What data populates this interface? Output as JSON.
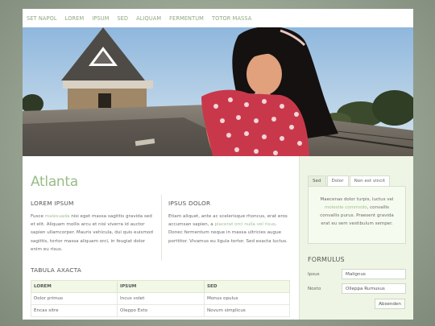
{
  "nav": {
    "items": [
      "Set Napol",
      "Lorem",
      "Ipsum",
      "Sed",
      "Aliquam",
      "Fermentum",
      "Totor Massa"
    ]
  },
  "site_title": "Atlanta",
  "col1": {
    "heading": "Lorem Ipsum",
    "text_a": "Fusce ",
    "link": "malesuada",
    "text_b": " nisi eget massa sagittis gravida sed et elit. Aliquam mollis arcu et nisi viverra id auctor sapien ullamcorper. Mauris vehicula, dui quis euismod sagittis, tortor massa aliquam orci, in feugiat dolor enim eu risus."
  },
  "col2": {
    "heading": "Ipsus Dolor",
    "text_a": "Etiam aliquet, ante ac scelerisque rhoncus, erat eros accumsan sapien, a ",
    "link": "placerat orci nulla vel risus",
    "text_b": ". Donec fermentum neque in massa ultricies augue porttitor. Vivamus eu ligula tortor. Sed exacta luctus."
  },
  "table": {
    "title": "Tabula Axacta",
    "headers": [
      "LOREM",
      "IPSUM",
      "SED"
    ],
    "rows": [
      [
        "Dolor primus",
        "Incus volet",
        "Monus opulus"
      ],
      [
        "Encas sitre",
        "Oleppo Exto",
        "Novum simplicus"
      ]
    ]
  },
  "sidebar": {
    "tabs": [
      "Sed",
      "Dolor",
      "Non est vincit"
    ],
    "box_text_a": "Maecenas dolor turpis, luctus vel ",
    "box_link": "molestie commodo",
    "box_text_b": ", convallis convallis purus. Praesent gravida erat eu sem vestibulum semper.",
    "form_title": "Formulus",
    "field1_label": "Ipsus",
    "field1_value": "Malignus",
    "field2_label": "Noxto",
    "field2_value": "Olleppa Rumusus",
    "submit_label": "Absenden"
  }
}
